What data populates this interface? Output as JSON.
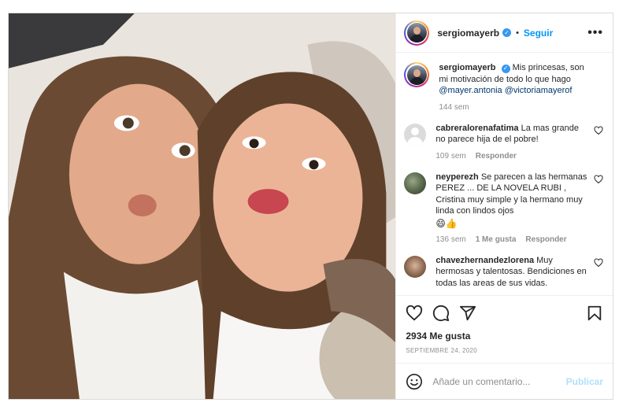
{
  "post": {
    "author": "sergiomayerb",
    "follow_label": "Seguir",
    "separator": "•",
    "more_label": "•••",
    "verified_glyph": "✓"
  },
  "caption": {
    "username": "sergiomayerb",
    "text": "Mis princesas, son mi motivación de todo lo que hago",
    "mention1": "@mayer.antonia",
    "mention2": "@victoriamayerof",
    "time": "144 sem"
  },
  "comments": [
    {
      "username": "cabreralorenafatima",
      "text": "La mas grande no parece hija de el pobre!",
      "time": "109 sem",
      "reply_label": "Responder",
      "likes": ""
    },
    {
      "username": "neyperezh",
      "text": "Se parecen a las hermanas PEREZ ... DE LA NOVELA RUBI , Cristina muy simple y la hermano muy linda con lindos ojos",
      "emojis": "😄👍",
      "time": "136 sem",
      "likes": "1 Me gusta",
      "reply_label": "Responder"
    },
    {
      "username": "chavezhernandezlorena",
      "text": "Muy hermosas y talentosas. Bendiciones en todas las areas de sus vidas."
    }
  ],
  "actions": {
    "likes": "2934 Me gusta",
    "date": "Septiembre 24, 2020"
  },
  "add_comment": {
    "placeholder": "Añade un comentario...",
    "publish_label": "Publicar"
  },
  "icons": {
    "like": "heart-icon",
    "comment": "comment-icon",
    "share": "share-icon",
    "save": "bookmark-icon",
    "emoji": "emoji-icon"
  },
  "colors": {
    "link": "#0095f6",
    "verified": "#3897f0",
    "mention": "#00376b",
    "muted": "#8e8e8e",
    "publish_disabled": "#b2dffc"
  }
}
